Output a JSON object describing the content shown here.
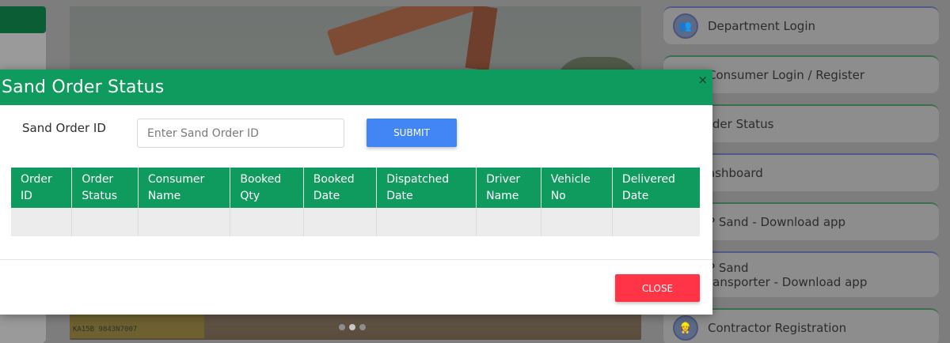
{
  "background": {
    "plate_text": "KA15B 9843N7007",
    "carousel": {
      "slide_count": 3,
      "active_index": 1
    },
    "side_menu": [
      {
        "label": "Department Login",
        "icon": "department-login-icon",
        "icon_glyph": "👥"
      },
      {
        "label": "Consumer Login / Register",
        "icon": "consumer-icon",
        "icon_glyph": ""
      },
      {
        "label": "Order Status",
        "icon": "",
        "icon_glyph": ""
      },
      {
        "label": "Dashboard",
        "icon": "",
        "icon_glyph": ""
      },
      {
        "label": "AP Sand - Download app",
        "icon": "",
        "icon_glyph": ""
      },
      {
        "label": "AP Sand Transporter - Download app",
        "icon": "",
        "icon_glyph": ""
      },
      {
        "label": "Contractor Registration",
        "icon": "contractor-icon",
        "icon_glyph": "👷"
      }
    ],
    "visible_side_labels": {
      "consumer": "Consumer Login / Register",
      "order_status": "rder Status",
      "dashboard": "ashboard",
      "ap_sand": "P Sand - Download app",
      "transporter_line1": "P Sand",
      "transporter_line2": "ransporter - Download app"
    }
  },
  "modal": {
    "title": "Sand Order Status",
    "close_glyph": "×",
    "form": {
      "label": "Sand Order ID",
      "input_value": "",
      "input_placeholder": "Enter Sand Order ID",
      "submit_label": "SUBMIT"
    },
    "table": {
      "headers": [
        [
          "Order",
          "ID"
        ],
        [
          "Order",
          "Status"
        ],
        [
          "Consumer",
          "Name"
        ],
        [
          "Booked",
          "Qty"
        ],
        [
          "Booked",
          "Date"
        ],
        [
          "Dispatched",
          "Date"
        ],
        [
          "Driver",
          "Name"
        ],
        [
          "Vehicle",
          "No"
        ],
        [
          "Delivered",
          "Date"
        ]
      ],
      "rows": [
        [
          "",
          "",
          "",
          "",
          "",
          "",
          "",
          "",
          ""
        ]
      ]
    },
    "close_label": "CLOSE"
  },
  "colors": {
    "header_green": "#0f9a5e",
    "submit_blue": "#4285f4",
    "close_red": "#ff3547"
  }
}
